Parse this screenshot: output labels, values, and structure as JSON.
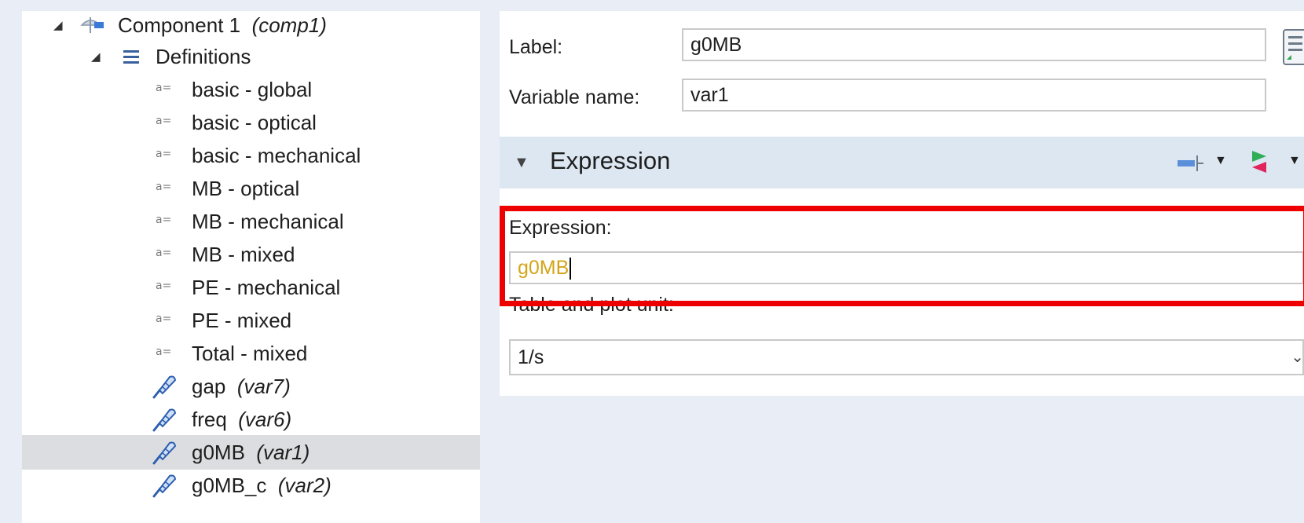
{
  "tree": {
    "items": [
      {
        "name": "Component 1",
        "tag": "(comp1)",
        "icon": "component-icon"
      },
      {
        "name": "Definitions",
        "tag": "",
        "icon": "definitions-icon"
      },
      {
        "name": "basic - global",
        "tag": "",
        "icon": "variables-icon"
      },
      {
        "name": "basic - optical",
        "tag": "",
        "icon": "variables-icon"
      },
      {
        "name": "basic - mechanical",
        "tag": "",
        "icon": "variables-icon"
      },
      {
        "name": "MB - optical",
        "tag": "",
        "icon": "variables-icon"
      },
      {
        "name": "MB - mechanical",
        "tag": "",
        "icon": "variables-icon"
      },
      {
        "name": "MB - mixed",
        "tag": "",
        "icon": "variables-icon"
      },
      {
        "name": "PE - mechanical",
        "tag": "",
        "icon": "variables-icon"
      },
      {
        "name": "PE - mixed",
        "tag": "",
        "icon": "variables-icon"
      },
      {
        "name": "Total - mixed",
        "tag": "",
        "icon": "variables-icon"
      },
      {
        "name": "gap",
        "tag": "(var7)",
        "icon": "probe-icon"
      },
      {
        "name": "freq",
        "tag": "(var6)",
        "icon": "probe-icon"
      },
      {
        "name": "g0MB",
        "tag": "(var1)",
        "icon": "probe-icon",
        "selected": true
      },
      {
        "name": "g0MB_c",
        "tag": "(var2)",
        "icon": "probe-icon"
      }
    ],
    "variables_glyph": "a="
  },
  "settings": {
    "label_caption": "Label:",
    "label_value": "g0MB",
    "varname_caption": "Variable name:",
    "varname_value": "var1",
    "section_title": "Expression",
    "expression_caption": "Expression:",
    "expression_value": "g0MB",
    "unit_caption": "Table and plot unit:",
    "unit_value": "1/s"
  },
  "colors": {
    "highlight": "#ee0000",
    "expression_text": "#d4a418",
    "selected_row": "#dcdde0",
    "section_header": "#dde7f2"
  }
}
